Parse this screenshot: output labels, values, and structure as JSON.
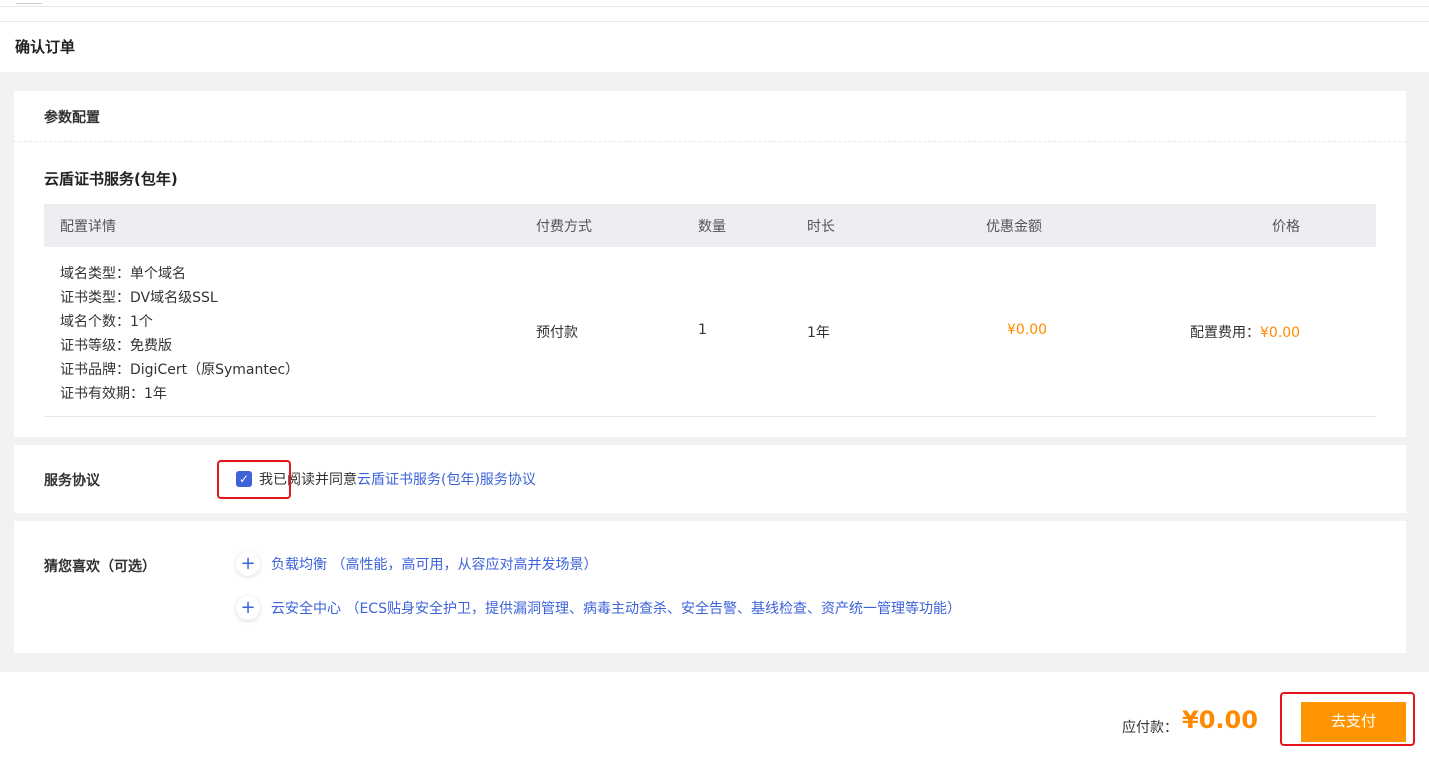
{
  "page": {
    "title": "确认订单"
  },
  "config": {
    "section_title": "参数配置",
    "product_name": "云盾证书服务(包年)",
    "table": {
      "headers": [
        "配置详情",
        "付费方式",
        "数量",
        "时长",
        "优惠金额",
        "价格"
      ],
      "details": [
        "域名类型：单个域名",
        "证书类型：DV域名级SSL",
        "域名个数：1个",
        "证书等级：免费版",
        "证书品牌：DigiCert（原Symantec）",
        "证书有效期：1年"
      ],
      "payment_method": "预付款",
      "quantity": "1",
      "duration": "1年",
      "discount": "¥0.00",
      "price_label": "配置费用：",
      "price_value": "¥0.00"
    }
  },
  "agreement": {
    "label": "服务协议",
    "checked": true,
    "check_mark": "✓",
    "text": "我已阅读并同意",
    "link_text": "云盾证书服务(包年)服务协议"
  },
  "recommend": {
    "label": "猜您喜欢（可选）",
    "plus_symbol": "+",
    "items": [
      "负载均衡 （高性能，高可用，从容应对高并发场景）",
      "云安全中心 （ECS贴身安全护卫，提供漏洞管理、病毒主动查杀、安全告警、基线检查、资产统一管理等功能）"
    ]
  },
  "footer": {
    "total_label": "应付款：",
    "total_value": "¥0.00",
    "pay_button": "去支付"
  },
  "colors": {
    "accent_orange": "#ff8a00",
    "link_blue": "#3d63d9",
    "highlight_red": "#e8141b"
  }
}
